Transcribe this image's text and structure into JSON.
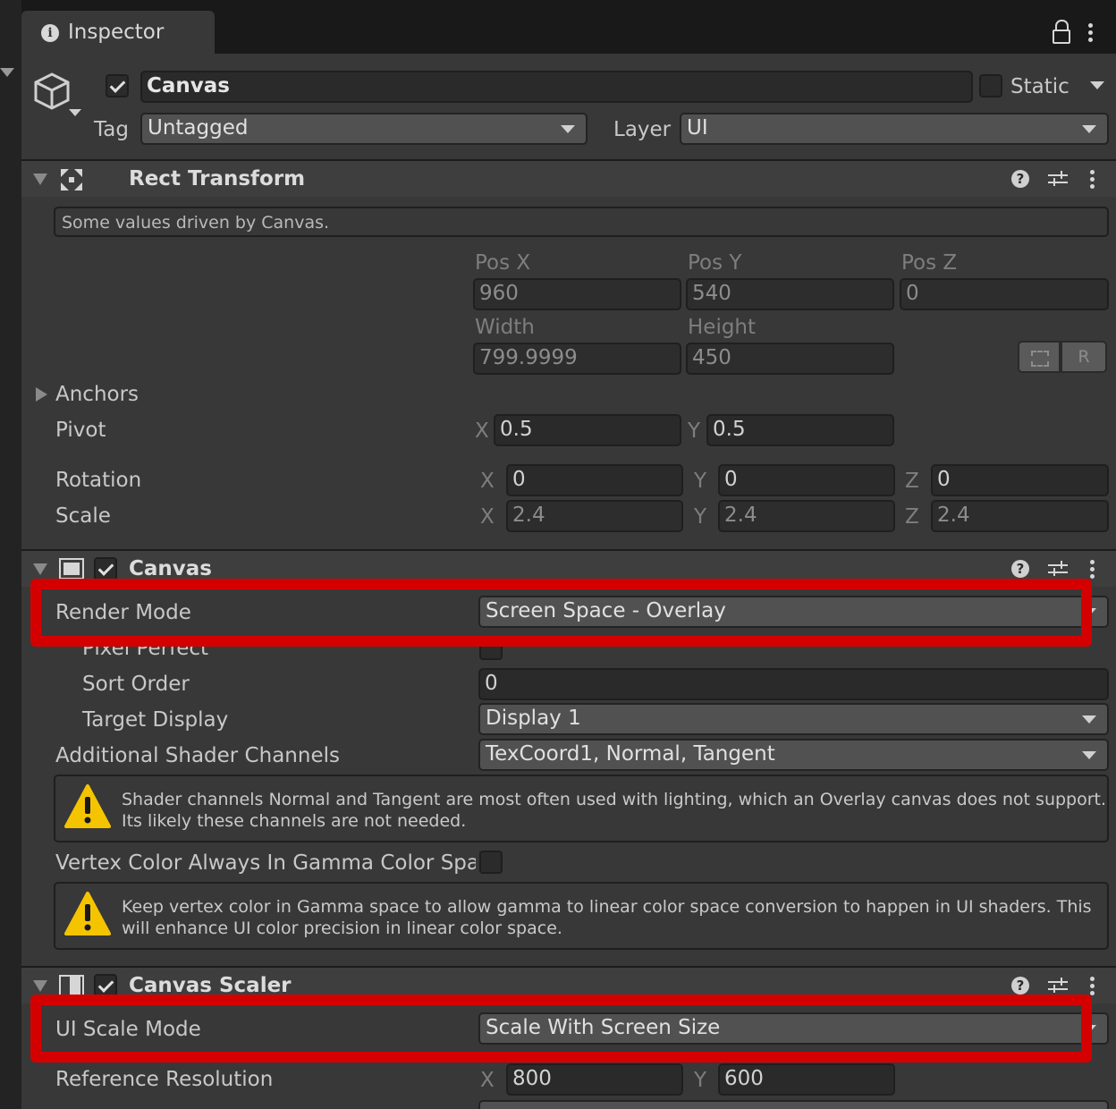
{
  "tab": {
    "title": "Inspector"
  },
  "header": {
    "object_name": "Canvas",
    "static_label": "Static",
    "tag_label": "Tag",
    "tag_value": "Untagged",
    "layer_label": "Layer",
    "layer_value": "UI"
  },
  "rect_transform": {
    "title": "Rect Transform",
    "info": "Some values driven by Canvas.",
    "pos_x_label": "Pos X",
    "pos_y_label": "Pos Y",
    "pos_z_label": "Pos Z",
    "pos_x": "960",
    "pos_y": "540",
    "pos_z": "0",
    "width_label": "Width",
    "height_label": "Height",
    "width": "799.9999",
    "height": "450",
    "anchors_label": "Anchors",
    "pivot_label": "Pivot",
    "pivot_x": "0.5",
    "pivot_y": "0.5",
    "rotation_label": "Rotation",
    "rot_x": "0",
    "rot_y": "0",
    "rot_z": "0",
    "scale_label": "Scale",
    "scale_x": "2.4",
    "scale_y": "2.4",
    "scale_z": "2.4",
    "x_label": "X",
    "y_label": "Y",
    "z_label": "Z",
    "raw_button": "R"
  },
  "canvas": {
    "title": "Canvas",
    "render_mode_label": "Render Mode",
    "render_mode_value": "Screen Space - Overlay",
    "pixel_perfect_label": "Pixel Perfect",
    "sort_order_label": "Sort Order",
    "sort_order_value": "0",
    "target_display_label": "Target Display",
    "target_display_value": "Display 1",
    "shader_channels_label": "Additional Shader Channels",
    "shader_channels_value": "TexCoord1, Normal, Tangent",
    "warning1_line1": "Shader channels Normal and Tangent are most often used with lighting, which an Overlay canvas does not support.",
    "warning1_line2": "Its likely these channels are not needed.",
    "vertex_color_label": "Vertex Color Always In Gamma Color Spa",
    "warning2_line1": "Keep vertex color in Gamma space to allow gamma to linear color space conversion to happen in UI shaders. This",
    "warning2_line2": "will enhance UI color precision in linear color space."
  },
  "canvas_scaler": {
    "title": "Canvas Scaler",
    "ui_scale_mode_label": "UI Scale Mode",
    "ui_scale_mode_value": "Scale With Screen Size",
    "ref_res_label": "Reference Resolution",
    "ref_x": "800",
    "ref_y": "600",
    "x_label": "X",
    "y_label": "Y"
  },
  "colors": {
    "highlight": "#d40000",
    "panel": "#383838",
    "header": "#3e3e3e",
    "warning": "#f5c400"
  }
}
